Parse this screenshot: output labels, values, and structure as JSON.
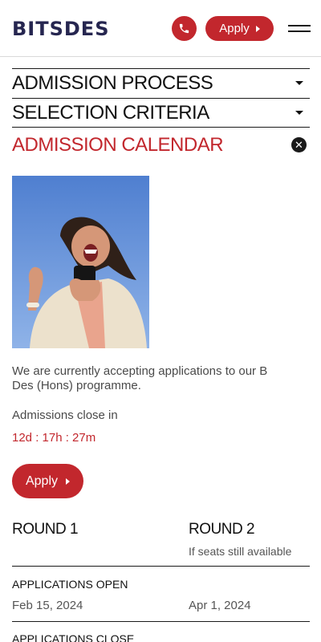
{
  "header": {
    "logo": "BITSDES",
    "apply_label": "Apply"
  },
  "accordion": [
    {
      "title": "ADMISSION PROCESS",
      "state": "collapsed"
    },
    {
      "title": "SELECTION CRITERIA",
      "state": "collapsed"
    },
    {
      "title": "ADMISSION CALENDAR",
      "state": "expanded"
    }
  ],
  "calendar": {
    "intro": "We are currently accepting applications to our B Des (Hons) programme.",
    "closes_label": "Admissions close in",
    "countdown": "12d : 17h : 27m",
    "apply_label": "Apply",
    "rounds": [
      {
        "title": "ROUND 1",
        "note": ""
      },
      {
        "title": "ROUND 2",
        "note": "If seats still available"
      }
    ],
    "rows": [
      {
        "label": "APPLICATIONS OPEN",
        "values": [
          "Feb 15, 2024",
          "Apr 1, 2024"
        ]
      },
      {
        "label": "APPLICATIONS CLOSE",
        "values": [
          "",
          ""
        ]
      }
    ]
  },
  "icons": {
    "phone": "phone-icon",
    "menu": "hamburger-menu-icon",
    "close": "close-icon",
    "caret": "chevron-down-icon",
    "arrow": "caret-right-icon"
  },
  "colors": {
    "brand_red": "#c2272d",
    "logo_navy": "#262650"
  }
}
